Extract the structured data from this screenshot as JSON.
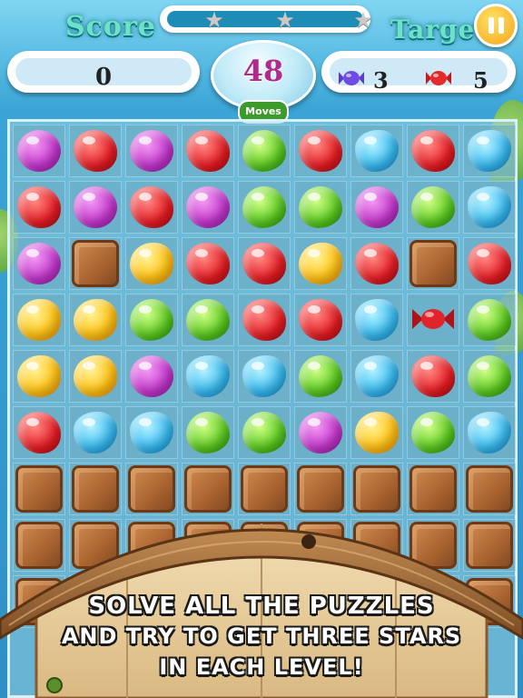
{
  "hud": {
    "score_title": "Score",
    "target_title": "Target",
    "score_value": "0",
    "moves_value": "48",
    "moves_label": "Moves",
    "stars_earned": 0,
    "stars_total": 3,
    "targets": [
      {
        "icon": "purple-candy-icon",
        "count": "3"
      },
      {
        "icon": "red-candy-icon",
        "count": "5"
      }
    ]
  },
  "board": {
    "rows": [
      [
        "purple",
        "red",
        "purple",
        "red",
        "green",
        "red",
        "blue",
        "red",
        "blue"
      ],
      [
        "red",
        "purple",
        "red",
        "purple",
        "green",
        "green",
        "purple",
        "green",
        "blue"
      ],
      [
        "purple",
        "crate",
        "yellow",
        "red",
        "red",
        "yellow",
        "red",
        "crate",
        "red"
      ],
      [
        "yellow",
        "yellow",
        "green",
        "green",
        "red",
        "red",
        "blue",
        "wrapped-red",
        "green"
      ],
      [
        "yellow",
        "yellow",
        "purple",
        "blue",
        "blue",
        "green",
        "blue",
        "red",
        "green"
      ],
      [
        "red",
        "blue",
        "blue",
        "green",
        "green",
        "purple",
        "yellow",
        "green",
        "blue"
      ],
      [
        "crate",
        "crate",
        "crate",
        "crate",
        "crate",
        "crate",
        "crate",
        "crate",
        "crate"
      ],
      [
        "crate",
        "crate",
        "crate",
        "crate",
        "crate",
        "crate",
        "crate",
        "crate",
        "crate"
      ],
      [
        "crate",
        "crate",
        "crate",
        "crate",
        "crate",
        "crate",
        "crate",
        "crate",
        "crate"
      ]
    ]
  },
  "banner": {
    "lines": [
      "SOLVE ALL THE PUZZLES",
      "AND TRY TO GET THREE STARS",
      "IN EACH LEVEL!"
    ]
  },
  "colors": {
    "title": "#6de3c6",
    "moves": "#b32a8f",
    "wood": "#a8622f"
  }
}
